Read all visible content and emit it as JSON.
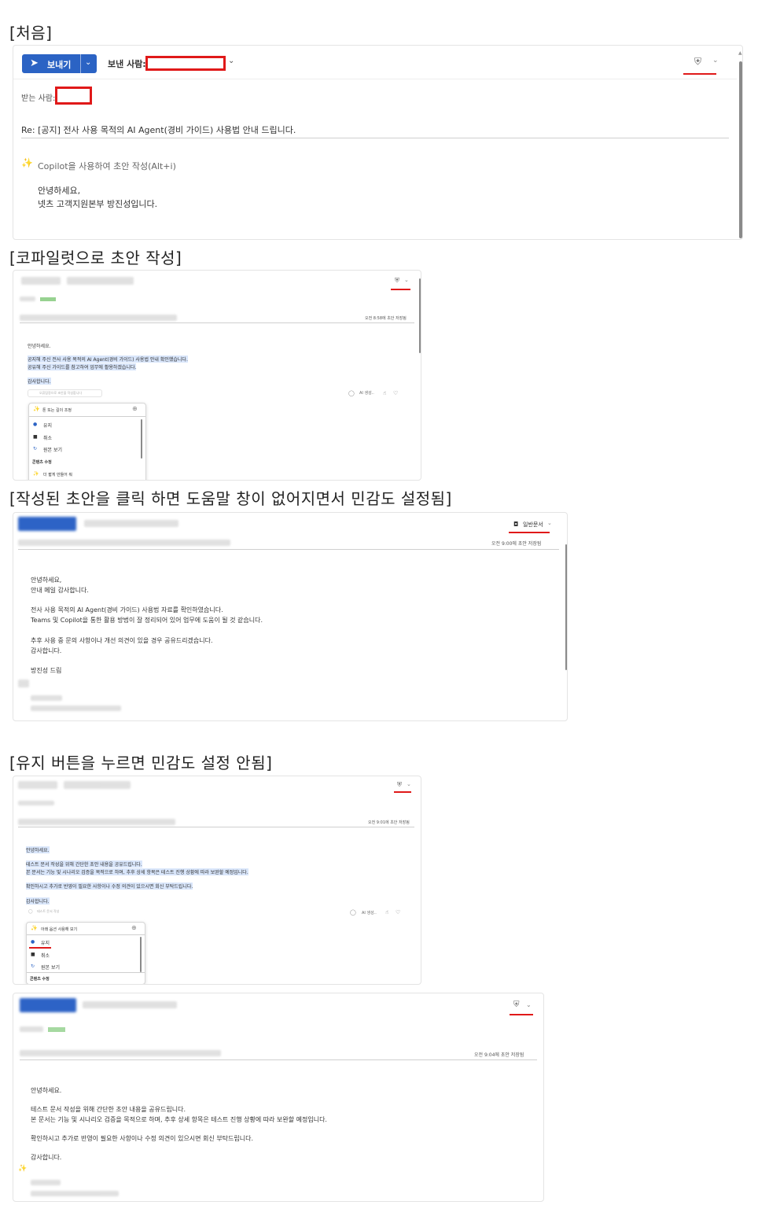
{
  "captions": {
    "first": "[처음]",
    "copilot_draft": "[코파일럿으로 초안 작성]",
    "click_draft": "[작성된 초안을 클릭 하면 도움말 창이 없어지면서 민감도 설정됨]",
    "keep_button": "[유지 버튼을 누르면 민감도 설정 안됨]"
  },
  "compose1": {
    "send_label": "보내기",
    "from_label": "보낸 사람:",
    "to_label": "받는 사람:",
    "subject": "Re: [공지] 전사 사용 목적의 AI Agent(경비 가이드) 사용법 안내 드립니다.",
    "copilot_hint": "Copilot을 사용하여 초안 작성(Alt+i)",
    "body_lines": [
      "안녕하세요,",
      "넷츠 고객지원본부 방진성입니다."
    ]
  },
  "compose2": {
    "saved": "오전 8:58에 초안 저장됨",
    "body_lines": [
      "안녕하세요.",
      "공지해 주신 전사 사용 목적의 AI Agent(경비 가이드) 사용법 안내 확인했습니다.",
      "공유해 주신 가이드를 참고하여 업무에 활용하겠습니다.",
      "감사합니다."
    ],
    "prompt_placeholder": "오류탐정으로 초안을 작성합니다",
    "ai_label": "AI 생성..",
    "panel": {
      "header": "톤 또는 길이 조정",
      "items": [
        "유지",
        "취소",
        "원본 보기"
      ],
      "section": "콘텐츠 수정",
      "extra": "더 짧게 만들어 줘"
    }
  },
  "compose3": {
    "label": "일반문서",
    "saved": "오전 9:00에 초안 저장됨",
    "body": [
      [
        "안녕하세요,",
        "안내 메일 감사합니다."
      ],
      [
        "전사 사용 목적의 AI Agent(경비 가이드) 사용법 자료를 확인하였습니다.",
        "Teams 및 Copilot을 통한 활용 방법이 잘 정리되어 있어 업무에 도움이 될 것 같습니다."
      ],
      [
        "추후 사용 중 문의 사항이나 개선 의견이 있을 경우 공유드리겠습니다.",
        "감사합니다."
      ],
      [
        "방진성 드림"
      ]
    ]
  },
  "compose4": {
    "saved": "오전 9:01에 초안 저장됨",
    "body_lines": [
      "안녕하세요.",
      "테스트 문서 작성을 위해 간단한 초안 내용을 공유드립니다.",
      "본 문서는 기능 및 시나리오 검증을 목적으로 하며, 추후 상세 항목은 테스트 진행 상황에 따라 보완할 예정입니다.",
      "확인하시고 추가로 반영이 필요한 사항이나 수정 의견이 있으시면 회신 부탁드립니다.",
      "감사합니다."
    ],
    "prompt_placeholder": "테스트 문서 작성",
    "ai_label": "AI 생성..",
    "panel": {
      "header": "아래 옵션 사용해 보기",
      "items": [
        "유지",
        "취소",
        "원본 보기"
      ],
      "section": "콘텐츠 수정"
    }
  },
  "compose5": {
    "saved": "오전 9:04에 초안 저장됨",
    "body": [
      [
        "안녕하세요."
      ],
      [
        "테스트 문서 작성을 위해 간단한 초안 내용을 공유드립니다.",
        "본 문서는 기능 및 시나리오 검증을 목적으로 하며, 추후 상세 항목은 테스트 진행 상황에 따라 보완할 예정입니다."
      ],
      [
        "확인하시고 추가로 반영이 필요한 사항이나 수정 의견이 있으시면 회신 부탁드립니다."
      ],
      [
        "감사합니다."
      ]
    ]
  },
  "colors": {
    "send_button": "#2b63c4",
    "highlight": "#d9e6fb",
    "red_mark": "#e01919"
  },
  "icons": [
    "send-icon",
    "chevron-down-icon",
    "shield-icon",
    "copilot-icon",
    "check-circle-icon",
    "trash-icon",
    "refresh-icon",
    "thumbs-up-icon",
    "thumbs-down-icon",
    "plus-circle-icon"
  ]
}
